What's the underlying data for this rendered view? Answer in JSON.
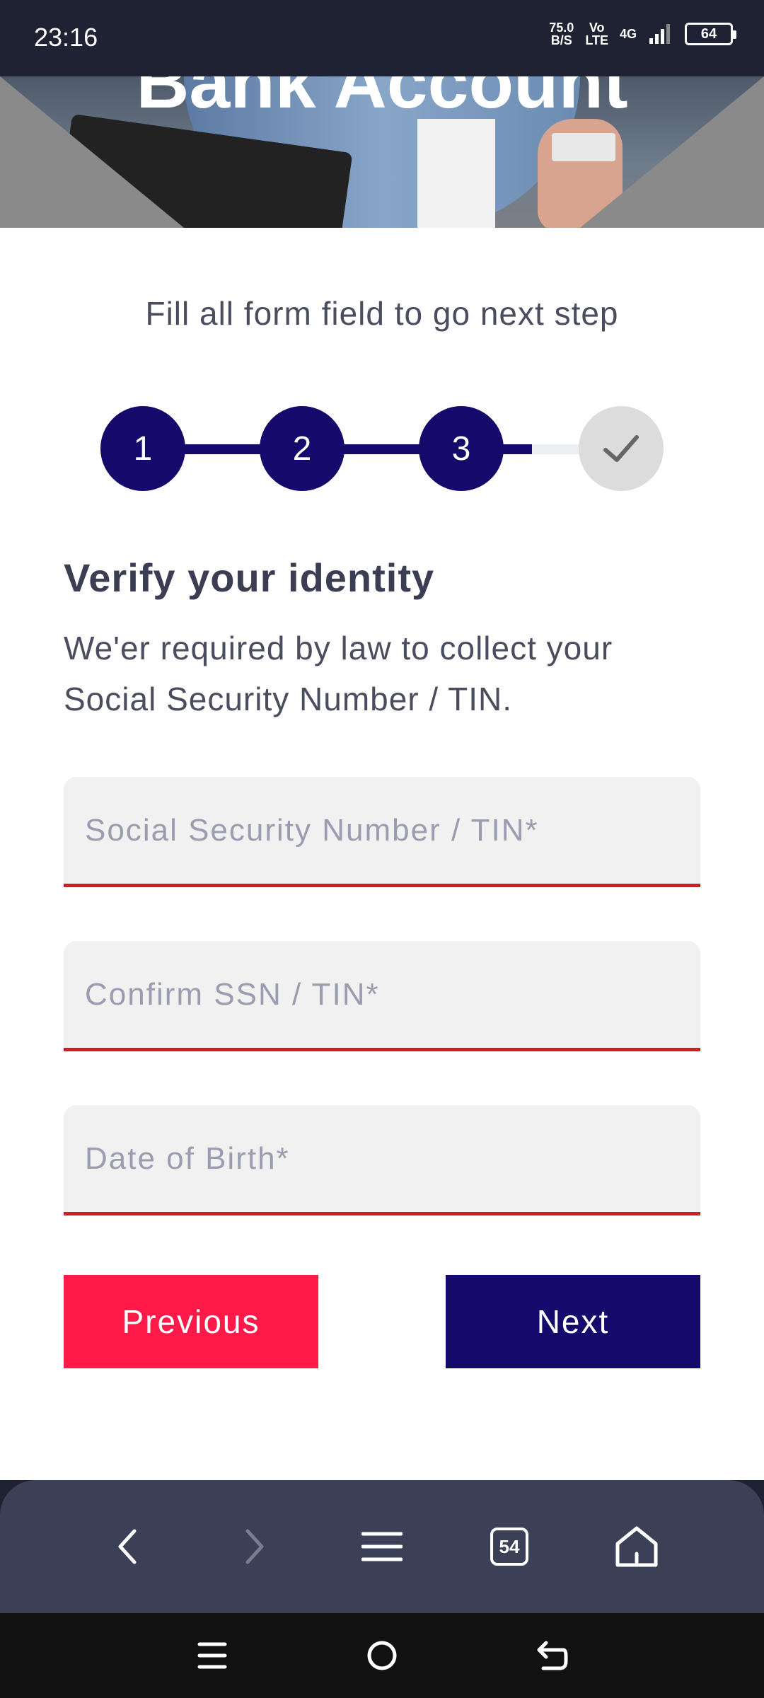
{
  "status_bar": {
    "time": "23:16",
    "net_speed_value": "75.0",
    "net_speed_unit": "B/S",
    "volte_top": "Vo",
    "volte_bottom": "LTE",
    "network": "4G",
    "battery": "64"
  },
  "hero": {
    "title": "Bank Account"
  },
  "form": {
    "subtitle": "Fill all form field to go next step",
    "steps": [
      "1",
      "2",
      "3"
    ],
    "section_title": "Verify your identity",
    "section_desc": "We'er required by law to collect your Social Security Number / TIN.",
    "fields": {
      "ssn_placeholder": "Social Security Number / TIN*",
      "confirm_placeholder": "Confirm SSN / TIN*",
      "dob_placeholder": "Date of Birth*"
    },
    "buttons": {
      "previous": "Previous",
      "next": "Next"
    }
  },
  "browser": {
    "tab_count": "54"
  },
  "colors": {
    "primary": "#150a6b",
    "accent": "#ff1a4a",
    "error_line": "#cc1c24"
  }
}
